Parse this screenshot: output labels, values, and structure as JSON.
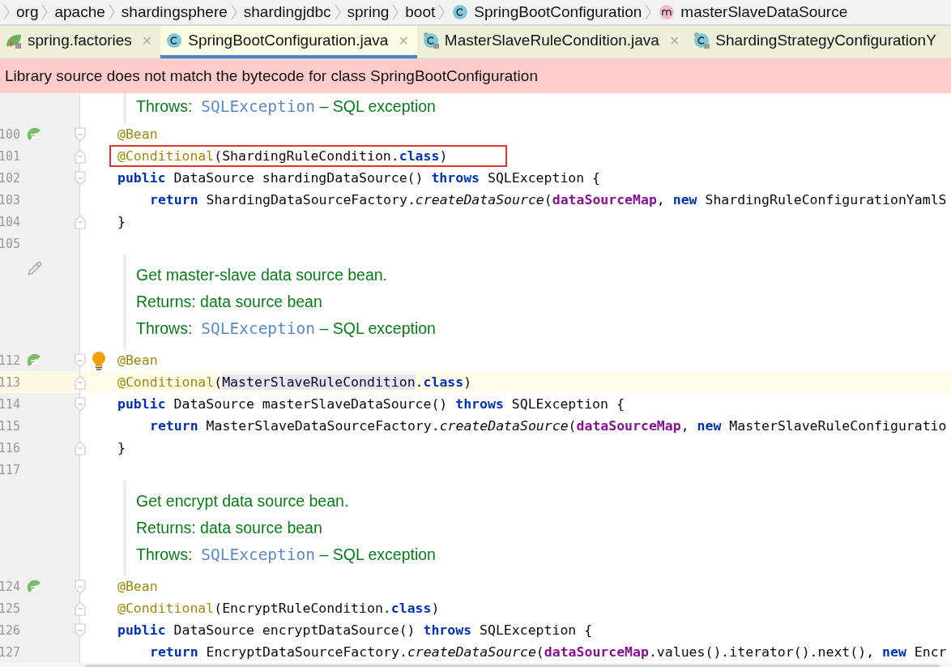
{
  "breadcrumb": [
    {
      "label": "org",
      "kind": "package"
    },
    {
      "label": "apache",
      "kind": "package"
    },
    {
      "label": "shardingsphere",
      "kind": "package"
    },
    {
      "label": "shardingjdbc",
      "kind": "package"
    },
    {
      "label": "spring",
      "kind": "package"
    },
    {
      "label": "boot",
      "kind": "package"
    },
    {
      "label": "SpringBootConfiguration",
      "kind": "class"
    },
    {
      "label": "masterSlaveDataSource",
      "kind": "method"
    }
  ],
  "tabs": [
    {
      "label": "spring.factories",
      "kind": "spring",
      "selected": false,
      "close": "✕"
    },
    {
      "label": "SpringBootConfiguration.java",
      "kind": "class",
      "selected": true,
      "close": "✕"
    },
    {
      "label": "MasterSlaveRuleCondition.java",
      "kind": "locked-class",
      "selected": false,
      "close": "✕"
    },
    {
      "label": "ShardingStrategyConfigurationY",
      "kind": "locked-class",
      "selected": false
    }
  ],
  "banner": {
    "text": "Library source does not match the bytecode for class SpringBootConfiguration"
  },
  "editor": {
    "rows": [
      {
        "kind": "doc-tail",
        "lines": [
          [
            {
              "kind": "doc",
              "text": "Throws:  "
            },
            {
              "kind": "link",
              "text": "SQLException"
            },
            {
              "kind": "doc",
              "text": " – SQL exception"
            }
          ]
        ]
      },
      {
        "kind": "code",
        "number": "100",
        "gutter": {
          "kind": "bean"
        },
        "fold": {
          "kind": "start"
        },
        "tokens": [
          {
            "kind": "ann",
            "text": "@Bean"
          }
        ]
      },
      {
        "kind": "code",
        "number": "101",
        "fold": {
          "kind": "end"
        },
        "boxed": true,
        "tokens": [
          {
            "kind": "ann",
            "text": "@Conditional"
          },
          {
            "kind": "plain",
            "text": "(ShardingRuleCondition."
          },
          {
            "kind": "kw",
            "text": "class"
          },
          {
            "kind": "plain",
            "text": ")"
          }
        ]
      },
      {
        "kind": "code",
        "number": "102",
        "fold": {
          "kind": "start"
        },
        "tokens": [
          {
            "kind": "kw",
            "text": "public"
          },
          {
            "kind": "plain",
            "text": " DataSource shardingDataSource() "
          },
          {
            "kind": "kw",
            "text": "throws"
          },
          {
            "kind": "plain",
            "text": " SQLException {"
          }
        ]
      },
      {
        "kind": "code",
        "number": "103",
        "indent": true,
        "tokens": [
          {
            "kind": "kw",
            "text": "return"
          },
          {
            "kind": "plain",
            "text": " ShardingDataSourceFactory."
          },
          {
            "kind": "italic",
            "text": "createDataSource"
          },
          {
            "kind": "plain",
            "text": "("
          },
          {
            "kind": "field",
            "text": "dataSourceMap"
          },
          {
            "kind": "plain",
            "text": ", "
          },
          {
            "kind": "kw",
            "text": "new"
          },
          {
            "kind": "plain",
            "text": " ShardingRuleConfigurationYamlS"
          }
        ]
      },
      {
        "kind": "code",
        "number": "104",
        "fold": {
          "kind": "end"
        },
        "tokens": [
          {
            "kind": "plain",
            "text": "}"
          }
        ]
      },
      {
        "kind": "code",
        "number": "105",
        "tokens": []
      },
      {
        "kind": "doc",
        "gutter": {
          "kind": "edit"
        },
        "lines": [
          [
            {
              "kind": "doc",
              "text": "Get master-slave data source bean."
            }
          ],
          [
            {
              "kind": "doc",
              "text": "Returns: data source bean"
            }
          ],
          [
            {
              "kind": "doc",
              "text": "Throws:  "
            },
            {
              "kind": "link",
              "text": "SQLException"
            },
            {
              "kind": "doc",
              "text": " – SQL exception"
            }
          ]
        ]
      },
      {
        "kind": "code",
        "number": "112",
        "gutter": {
          "kind": "bean"
        },
        "fold": {
          "kind": "start"
        },
        "bulb": true,
        "tokens": [
          {
            "kind": "ann",
            "text": "@Bean"
          }
        ]
      },
      {
        "kind": "code",
        "number": "113",
        "fold": {
          "kind": "end"
        },
        "current": true,
        "tokens": [
          {
            "kind": "ann",
            "text": "@Conditional"
          },
          {
            "kind": "plain",
            "text": "("
          },
          {
            "kind": "plain",
            "text": "MasterSlaveRuleCondition",
            "highlighted": true
          },
          {
            "kind": "plain",
            "text": "."
          },
          {
            "kind": "kw",
            "text": "class"
          },
          {
            "kind": "plain",
            "text": ")"
          }
        ]
      },
      {
        "kind": "code",
        "number": "114",
        "fold": {
          "kind": "start"
        },
        "tokens": [
          {
            "kind": "kw",
            "text": "public"
          },
          {
            "kind": "plain",
            "text": " DataSource masterSlaveDataSource() "
          },
          {
            "kind": "kw",
            "text": "throws"
          },
          {
            "kind": "plain",
            "text": " SQLException {"
          }
        ]
      },
      {
        "kind": "code",
        "number": "115",
        "indent": true,
        "tokens": [
          {
            "kind": "kw",
            "text": "return"
          },
          {
            "kind": "plain",
            "text": " MasterSlaveDataSourceFactory."
          },
          {
            "kind": "italic",
            "text": "createDataSource"
          },
          {
            "kind": "plain",
            "text": "("
          },
          {
            "kind": "field",
            "text": "dataSourceMap"
          },
          {
            "kind": "plain",
            "text": ", "
          },
          {
            "kind": "kw",
            "text": "new"
          },
          {
            "kind": "plain",
            "text": " MasterSlaveRuleConfiguratio"
          }
        ]
      },
      {
        "kind": "code",
        "number": "116",
        "fold": {
          "kind": "end"
        },
        "tokens": [
          {
            "kind": "plain",
            "text": "}"
          }
        ]
      },
      {
        "kind": "code",
        "number": "117",
        "tokens": []
      },
      {
        "kind": "doc",
        "lines": [
          [
            {
              "kind": "doc",
              "text": "Get encrypt data source bean."
            }
          ],
          [
            {
              "kind": "doc",
              "text": "Returns: data source bean"
            }
          ],
          [
            {
              "kind": "doc",
              "text": "Throws:  "
            },
            {
              "kind": "link",
              "text": "SQLException"
            },
            {
              "kind": "doc",
              "text": " – SQL exception"
            }
          ]
        ]
      },
      {
        "kind": "code",
        "number": "124",
        "gutter": {
          "kind": "bean"
        },
        "fold": {
          "kind": "start"
        },
        "tokens": [
          {
            "kind": "ann",
            "text": "@Bean"
          }
        ]
      },
      {
        "kind": "code",
        "number": "125",
        "fold": {
          "kind": "end"
        },
        "tokens": [
          {
            "kind": "ann",
            "text": "@Conditional"
          },
          {
            "kind": "plain",
            "text": "(EncryptRuleCondition."
          },
          {
            "kind": "kw",
            "text": "class"
          },
          {
            "kind": "plain",
            "text": ")"
          }
        ]
      },
      {
        "kind": "code",
        "number": "126",
        "fold": {
          "kind": "start"
        },
        "tokens": [
          {
            "kind": "kw",
            "text": "public"
          },
          {
            "kind": "plain",
            "text": " DataSource encryptDataSource() "
          },
          {
            "kind": "kw",
            "text": "throws"
          },
          {
            "kind": "plain",
            "text": " SQLException {"
          }
        ]
      },
      {
        "kind": "code",
        "number": "127",
        "indent": true,
        "tokens": [
          {
            "kind": "kw",
            "text": "return"
          },
          {
            "kind": "plain",
            "text": " EncryptDataSourceFactory."
          },
          {
            "kind": "italic",
            "text": "createDataSource"
          },
          {
            "kind": "plain",
            "text": "("
          },
          {
            "kind": "field",
            "text": "dataSourceMap"
          },
          {
            "kind": "plain",
            "text": ".values().iterator().next(), "
          },
          {
            "kind": "kw",
            "text": "new"
          },
          {
            "kind": "plain",
            "text": " Encr"
          }
        ]
      }
    ]
  }
}
